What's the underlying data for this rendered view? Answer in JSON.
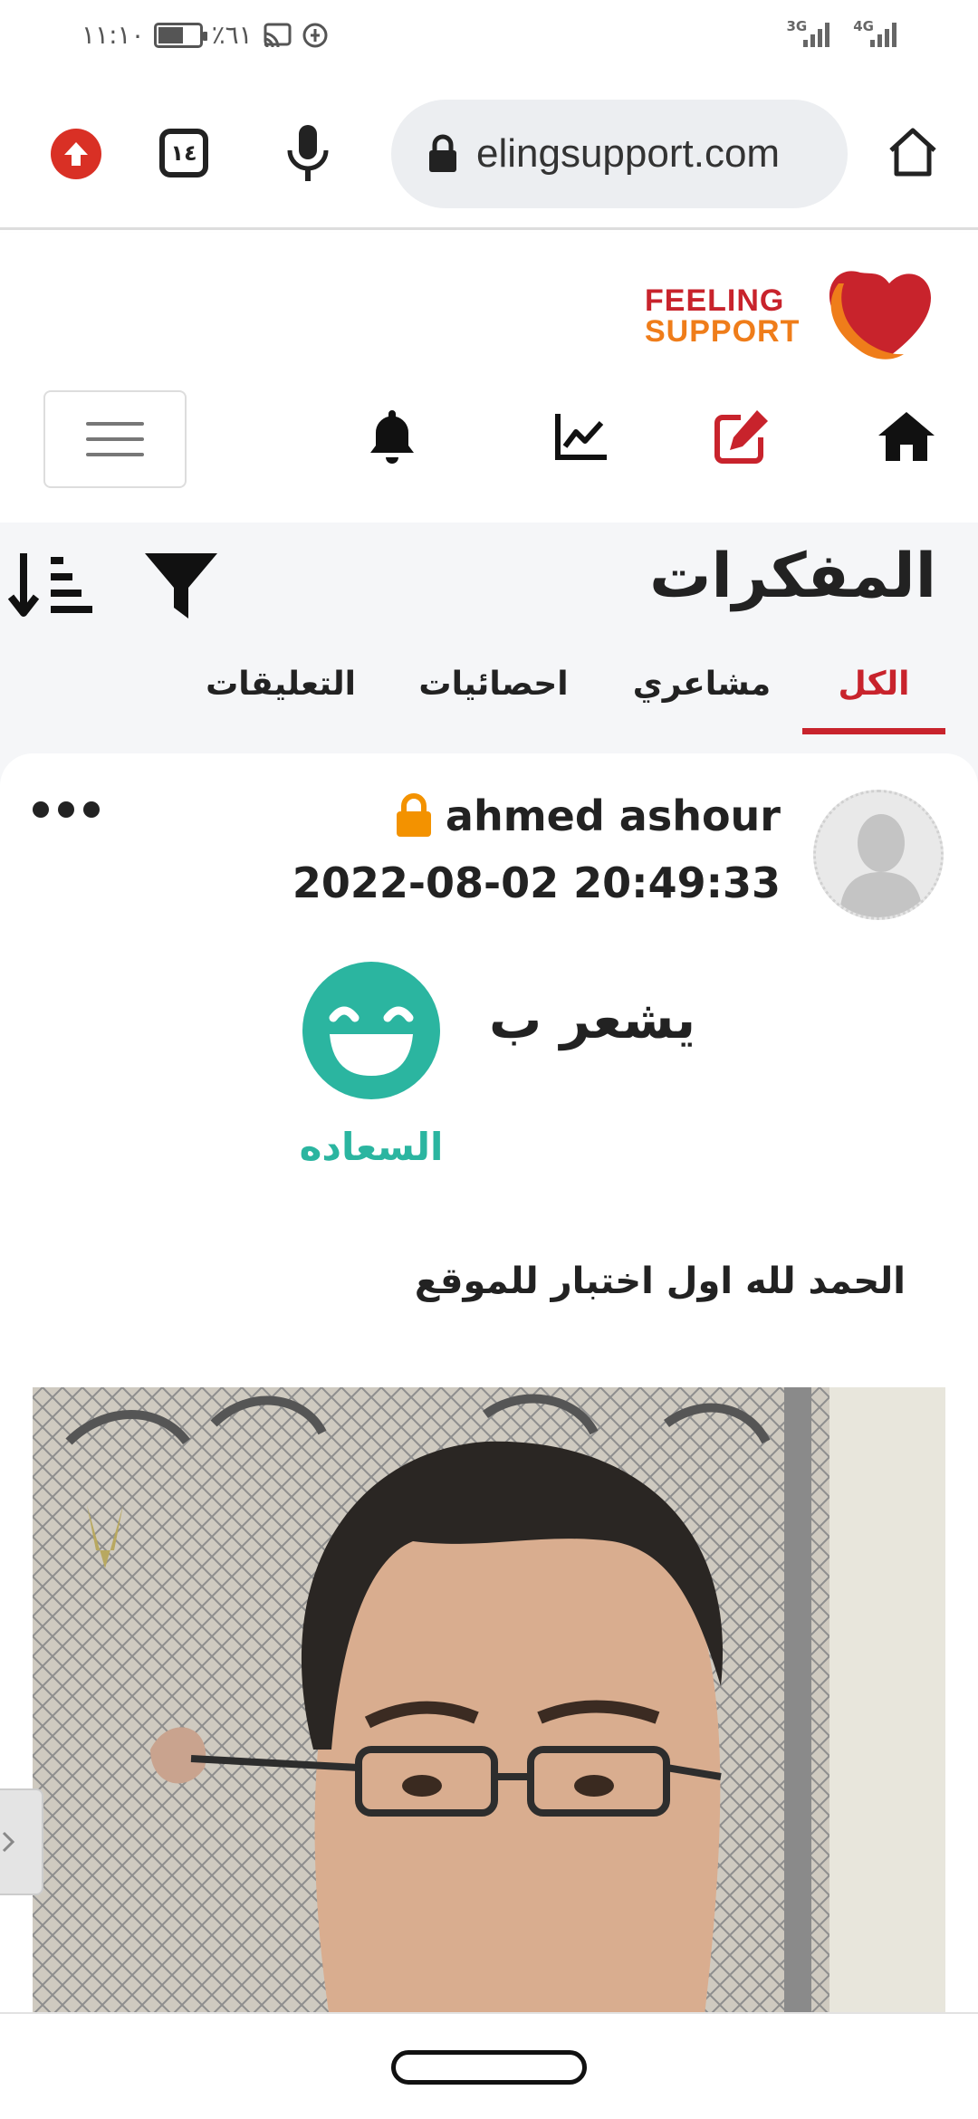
{
  "status_bar": {
    "time": "١١:١٠",
    "battery_percent": "٪٦١",
    "battery_level": 0.61,
    "network_1": "3G",
    "network_2": "4G"
  },
  "browser": {
    "url": "elingsupport.com",
    "tab_count": "١٤",
    "icons": [
      "update-icon",
      "tabs-icon",
      "mic-icon",
      "lock-icon",
      "home-icon"
    ]
  },
  "site": {
    "logo_line1": "FEELING",
    "logo_line2": "SUPPORT",
    "nav_icons": [
      "home-icon",
      "edit-icon",
      "chart-icon",
      "bell-icon",
      "menu-icon"
    ]
  },
  "page": {
    "title": "المفكرات",
    "tabs": [
      {
        "label": "الكل",
        "active": true
      },
      {
        "label": "مشاعري",
        "active": false
      },
      {
        "label": "احصائيات",
        "active": false
      },
      {
        "label": "التعليقات",
        "active": false
      }
    ]
  },
  "post": {
    "username": "ahmed ashour",
    "date": "2022-08-02 20:49:33",
    "feels_label": "يشعر ب",
    "emotion": "السعاده",
    "text": "الحمد لله اول اختبار للموقع"
  },
  "colors": {
    "brand_red": "#c8232c",
    "brand_orange": "#ef7d1a",
    "emotion_teal": "#2bb5a0",
    "lock_orange": "#f39200"
  }
}
